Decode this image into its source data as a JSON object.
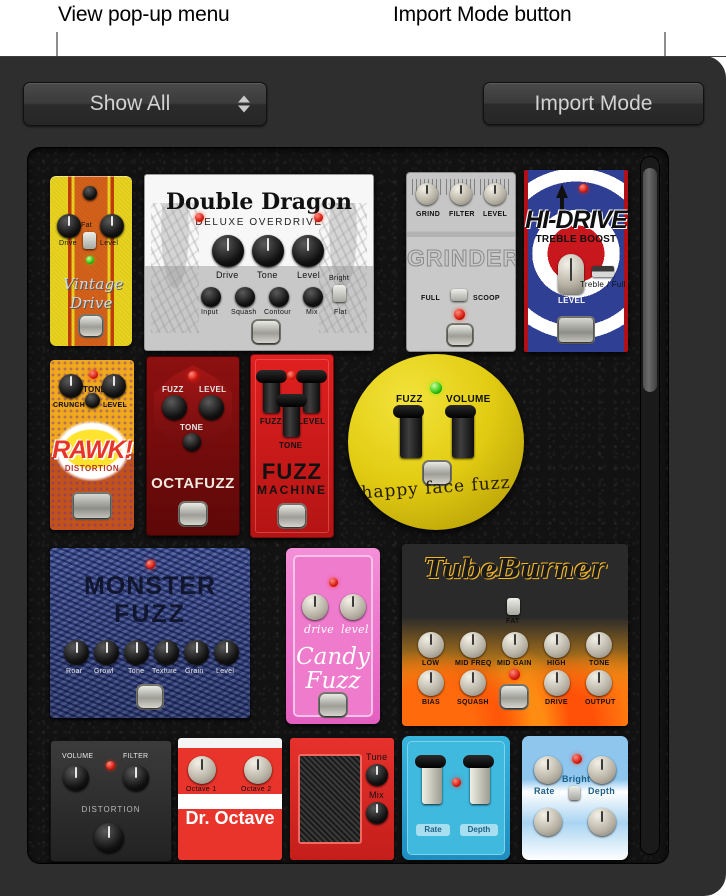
{
  "annotations": [
    {
      "id": "view-popup-callout",
      "text": "View pop-up menu"
    },
    {
      "id": "import-mode-callout",
      "text": "Import Mode button"
    }
  ],
  "toolbar": {
    "view_popup": {
      "label": "Show All",
      "stepper_icon": "stepper-arrows-icon"
    },
    "import_mode": {
      "label": "Import Mode"
    }
  },
  "scrollbar": {
    "orientation": "vertical",
    "thumb_position_percent": 2,
    "thumb_size_percent": 32
  },
  "browser": {
    "title": "pedal-browser",
    "pedals": [
      {
        "id": "vintage-drive",
        "name_lines": [
          "Vintage",
          "Drive"
        ],
        "knobs": [
          "Drive",
          "Level"
        ],
        "switches": [
          "Fat"
        ],
        "leds": [
          "green"
        ]
      },
      {
        "id": "double-dragon",
        "title": "Double Dragon",
        "subtitle": "DELUXE OVERDRIVE",
        "knobs_top": [
          "Drive",
          "Tone",
          "Level"
        ],
        "knobs_bottom": [
          "Input",
          "Squash",
          "Contour",
          "Mix"
        ],
        "switches": [
          "Bright",
          "Flat"
        ],
        "leds": [
          "red",
          "red"
        ]
      },
      {
        "id": "grinder",
        "title": "GRINDER",
        "knobs": [
          "GRIND",
          "FILTER",
          "LEVEL"
        ],
        "switch_labels": [
          "FULL",
          "SCOOP"
        ],
        "leds": [
          "red"
        ]
      },
      {
        "id": "hi-drive",
        "title": "HI-DRIVE",
        "subtitle": "TREBLE BOOST",
        "knobs": [
          "LEVEL"
        ],
        "switch_labels": [
          "Treble / Full"
        ],
        "leds": [
          "red"
        ]
      },
      {
        "id": "rawk-distortion",
        "title": "RAWK!",
        "subtitle": "DISTORTION",
        "knobs": [
          "CRUNCH",
          "TONE",
          "LEVEL"
        ],
        "leds": [
          "red"
        ]
      },
      {
        "id": "octafuzz",
        "title": "OCTAFUZZ",
        "knobs": [
          "FUZZ",
          "LEVEL",
          "TONE"
        ],
        "leds": [
          "red"
        ]
      },
      {
        "id": "fuzz-machine",
        "title_lines": [
          "FUZZ",
          "MACHINE"
        ],
        "knobs": [
          "FUZZ",
          "LEVEL",
          "TONE"
        ],
        "leds": [
          "red"
        ]
      },
      {
        "id": "happy-face-fuzz",
        "title": "happy face fuzz",
        "knobs": [
          "FUZZ",
          "VOLUME"
        ],
        "leds": [
          "green"
        ]
      },
      {
        "id": "monster-fuzz",
        "title_lines": [
          "MONSTER",
          "FUZZ"
        ],
        "knobs": [
          "Roar",
          "Growl",
          "Tone",
          "Texture",
          "Grain",
          "Level"
        ],
        "leds": [
          "red"
        ]
      },
      {
        "id": "candy-fuzz",
        "title_lines": [
          "Candy",
          "Fuzz"
        ],
        "knobs": [
          "drive",
          "level"
        ],
        "leds": [
          "red"
        ]
      },
      {
        "id": "tube-burner",
        "title": "TubeBurner",
        "knobs_top": [
          "LOW",
          "MID FREQ",
          "MID GAIN",
          "HIGH",
          "TONE"
        ],
        "knobs_bottom": [
          "BIAS",
          "SQUASH",
          "DRIVE",
          "OUTPUT"
        ],
        "switches": [
          "FAT"
        ],
        "leds": [
          "red"
        ]
      },
      {
        "id": "distortion-pedal",
        "title": "DISTORTION",
        "knobs": [
          "VOLUME",
          "FILTER"
        ],
        "leds": [
          "red"
        ]
      },
      {
        "id": "dr-octave",
        "title": "Dr. Octave",
        "knobs": [
          "Octave 1",
          "Octave 2"
        ]
      },
      {
        "id": "red-pedal",
        "knobs": [
          "Tune",
          "Mix"
        ]
      },
      {
        "id": "cyan-modulation",
        "knobs": [
          "Rate",
          "Depth"
        ],
        "leds": [
          "red"
        ]
      },
      {
        "id": "sky-chorus",
        "knobs": [
          "Rate",
          "Depth"
        ],
        "switches": [
          "Bright"
        ],
        "leds": [
          "red"
        ]
      }
    ]
  }
}
